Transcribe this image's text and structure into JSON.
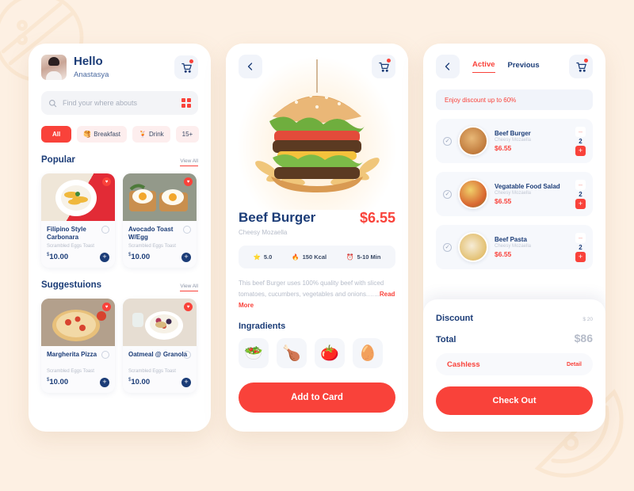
{
  "theme": {
    "accent": "#f9423a",
    "navy": "#1b3c77",
    "bg": "#fdf0e3"
  },
  "home": {
    "greeting": "Hello",
    "username": "Anastasya",
    "cart_icon": "cart-icon",
    "search": {
      "placeholder": "Find your where abouts",
      "search_icon": "search-icon",
      "grid_icon": "grid-icon"
    },
    "chips": [
      {
        "label": "All",
        "emoji": "",
        "active": true
      },
      {
        "label": "Breakfast",
        "emoji": "🥞",
        "active": false
      },
      {
        "label": "Drink",
        "emoji": "🍹",
        "active": false
      },
      {
        "label": "15+",
        "emoji": "",
        "active": false
      }
    ],
    "sections": [
      {
        "title": "Popular",
        "view_all": "View All",
        "items": [
          {
            "name": "Filipino Style Carbonara",
            "sub": "Scrambled Eggs Toast",
            "price": "10.00",
            "currency": "$"
          },
          {
            "name": "Avocado Toast W/Egg",
            "sub": "Scrambled Eggs Toast",
            "price": "10.00",
            "currency": "$"
          }
        ]
      },
      {
        "title": "Suggestuions",
        "view_all": "View All",
        "items": [
          {
            "name": "Margherita Pizza",
            "sub": "Scrambled Eggs Toast",
            "price": "10.00",
            "currency": "$"
          },
          {
            "name": "Oatmeal @ Granola",
            "sub": "Scrambled Eggs Toast",
            "price": "10.00",
            "currency": "$"
          }
        ]
      }
    ]
  },
  "detail": {
    "back_icon": "chevron-left-icon",
    "cart_icon": "cart-icon",
    "name": "Beef Burger",
    "sub": "Cheesy Mozaella",
    "price": "$6.55",
    "stats": [
      {
        "icon": "⭐",
        "value": "5.0"
      },
      {
        "icon": "🔥",
        "value": "150 Kcal"
      },
      {
        "icon": "⏰",
        "value": "5-10 Min"
      }
    ],
    "description": "This beef Burger uses 100% quality beef with sliced tomatoes, cucumbers, vegetables and onions.…...",
    "read_more": "Read More",
    "ingredients_title": "Ingradients",
    "ingredients": [
      {
        "name": "vegetables-icon",
        "emoji": "🥗"
      },
      {
        "name": "roast-chicken-icon",
        "emoji": "🍗"
      },
      {
        "name": "tomato-icon",
        "emoji": "🍅"
      },
      {
        "name": "egg-icon",
        "emoji": "🥚"
      }
    ],
    "cta": "Add to Card"
  },
  "cart": {
    "back_icon": "chevron-left-icon",
    "cart_icon": "cart-icon",
    "tabs": [
      {
        "label": "Active",
        "active": true
      },
      {
        "label": "Previous",
        "active": false
      }
    ],
    "promo": "Enjoy discount up to 60%",
    "items": [
      {
        "name": "Beef Burger",
        "sub": "Cheesy Mozaella",
        "price": "$6.55",
        "qty": "2",
        "minus": "–",
        "plus": "+",
        "check": "✓"
      },
      {
        "name": "Vegatable  Food Salad",
        "sub": "Cheesy Mozaella",
        "price": "$6.55",
        "qty": "2",
        "minus": "–",
        "plus": "+",
        "check": "✓"
      },
      {
        "name": "Beef Pasta",
        "sub": "Cheesy Mozaella",
        "price": "$6.55",
        "qty": "2",
        "minus": "–",
        "plus": "+",
        "check": "✓"
      }
    ],
    "summary": {
      "discount_label": "Discount",
      "discount_value": "$ 20",
      "total_label": "Total",
      "total_value": "$86",
      "payment_method": "Cashless",
      "payment_detail": "Detail",
      "checkout": "Check Out"
    }
  }
}
